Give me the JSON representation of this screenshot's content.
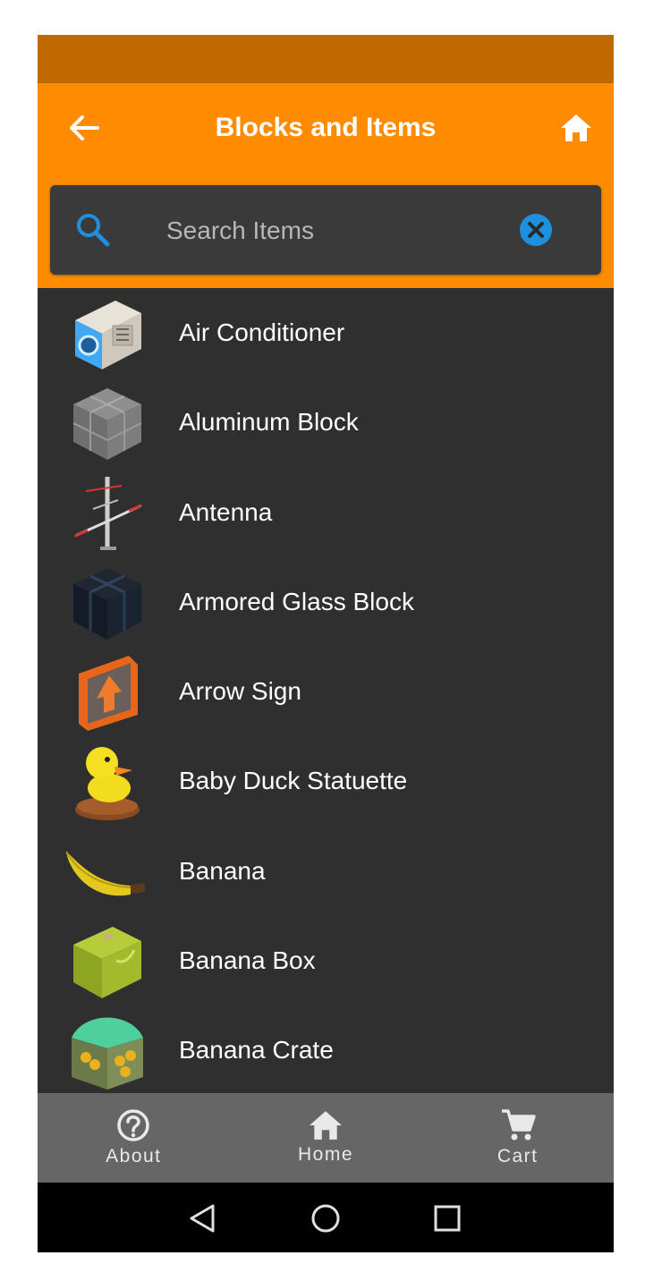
{
  "appbar": {
    "title": "Blocks and Items"
  },
  "search": {
    "placeholder": "Search Items",
    "value": ""
  },
  "items": [
    {
      "label": "Air Conditioner",
      "icon": "air-conditioner"
    },
    {
      "label": "Aluminum Block",
      "icon": "aluminum-block"
    },
    {
      "label": "Antenna",
      "icon": "antenna"
    },
    {
      "label": "Armored Glass Block",
      "icon": "armored-glass-block"
    },
    {
      "label": "Arrow Sign",
      "icon": "arrow-sign"
    },
    {
      "label": "Baby Duck Statuette",
      "icon": "baby-duck-statuette"
    },
    {
      "label": "Banana",
      "icon": "banana"
    },
    {
      "label": "Banana Box",
      "icon": "banana-box"
    },
    {
      "label": "Banana Crate",
      "icon": "banana-crate"
    }
  ],
  "bottomnav": [
    {
      "label": "About",
      "icon": "help-circle-icon"
    },
    {
      "label": "Home",
      "icon": "home-icon"
    },
    {
      "label": "Cart",
      "icon": "cart-icon"
    }
  ],
  "colors": {
    "accent": "#ff8c00",
    "statusbar": "#bf6900",
    "background": "#2f2f2f",
    "nav": "#666666",
    "search_icon": "#1e90e0"
  }
}
